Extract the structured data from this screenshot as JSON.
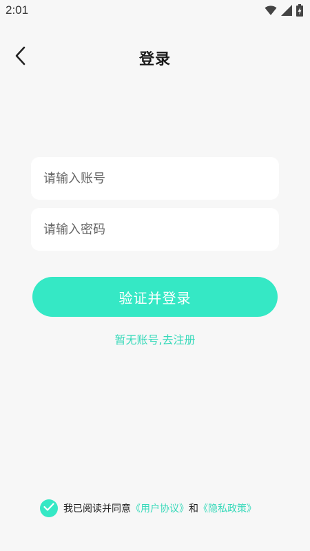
{
  "status_bar": {
    "time": "2:01",
    "icons": [
      "wifi-icon",
      "signal-icon",
      "battery-charging-icon"
    ]
  },
  "header": {
    "title": "登录",
    "back_icon": "chevron-left-icon"
  },
  "form": {
    "account_placeholder": "请输入账号",
    "account_value": "",
    "password_placeholder": "请输入密码",
    "password_value": "",
    "submit_label": "验证并登录",
    "register_link": "暂无账号,去注册"
  },
  "agreement": {
    "checked": true,
    "prefix": "我已阅读并同意",
    "user_agreement": "《用户协议》",
    "conjunction": "和",
    "privacy_policy": "《隐私政策》"
  },
  "colors": {
    "accent": "#35e8c5",
    "link": "#35d9b9",
    "background": "#f7f7f7"
  }
}
